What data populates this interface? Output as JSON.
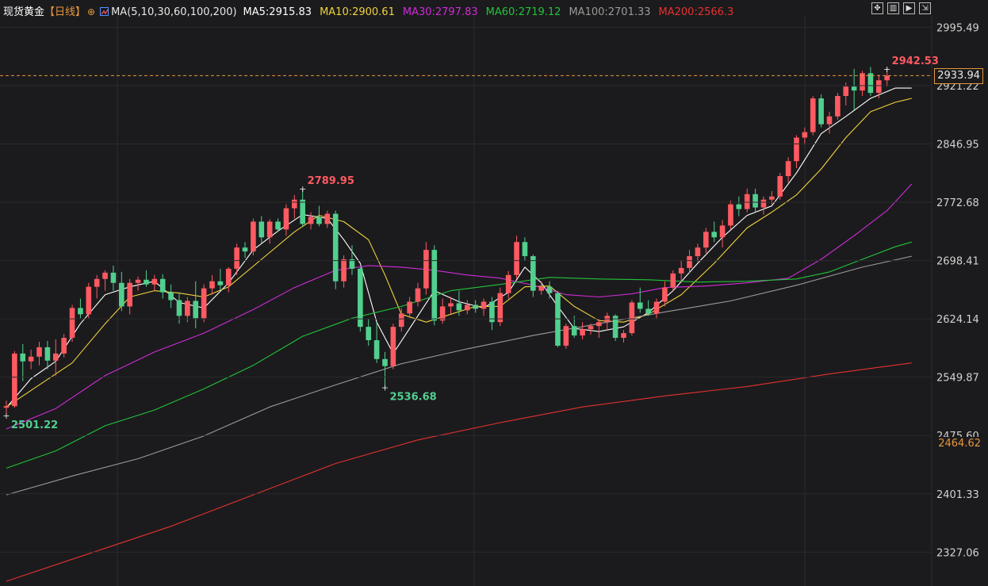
{
  "header": {
    "symbol": "现货黄金",
    "period": "【日线】",
    "period_icon": "circle-plus-icon",
    "ma_icon": "ma-indicator-icon",
    "ma_params": "MA(5,10,30,60,100,200)",
    "ma_values": [
      {
        "text": "MA5:2915.83",
        "color": "#ffffff"
      },
      {
        "text": "MA10:2900.61",
        "color": "#f0d23c"
      },
      {
        "text": "MA30:2797.83",
        "color": "#d02bd8"
      },
      {
        "text": "MA60:2719.12",
        "color": "#22c33a"
      },
      {
        "text": "MA100:2701.33",
        "color": "#9a9a9a"
      },
      {
        "text": "MA200:2566.3",
        "color": "#e5312e"
      }
    ]
  },
  "toolbar": {
    "buttons": [
      "move-icon",
      "chart-type-icon",
      "play-icon",
      "expand-icon"
    ]
  },
  "colors": {
    "background": "#1b1b1d",
    "up": "#ff5a62",
    "down": "#52cf8f",
    "last_price_line": "#e8963c",
    "grid": "#2b2b2e"
  },
  "chart_data": {
    "type": "candlestick",
    "ylim": [
      2290,
      3005
    ],
    "y_ticks": [
      "2995.49",
      "2921.22",
      "2846.95",
      "2772.68",
      "2698.41",
      "2624.14",
      "2549.87",
      "2475.60",
      "2401.33",
      "2327.06"
    ],
    "last_price": "2933.94",
    "period_low_label": "2464.62",
    "annotations": [
      {
        "text": "2942.53",
        "bar": 107,
        "value": 2942.53,
        "kind": "high"
      },
      {
        "text": "2789.95",
        "bar": 36,
        "value": 2789.95,
        "kind": "high"
      },
      {
        "text": "2536.68",
        "bar": 46,
        "value": 2536.68,
        "kind": "low"
      },
      {
        "text": "2501.22",
        "bar": 0,
        "value": 2501.22,
        "kind": "low"
      }
    ],
    "candles": [
      [
        2511,
        2520,
        2501.22,
        2513
      ],
      [
        2513,
        2583,
        2511,
        2580
      ],
      [
        2580,
        2592,
        2545,
        2570
      ],
      [
        2570,
        2585,
        2560,
        2576
      ],
      [
        2576,
        2595,
        2565,
        2588
      ],
      [
        2588,
        2596,
        2560,
        2571
      ],
      [
        2571,
        2598,
        2552,
        2580
      ],
      [
        2580,
        2605,
        2575,
        2600
      ],
      [
        2600,
        2642,
        2595,
        2638
      ],
      [
        2638,
        2650,
        2625,
        2630
      ],
      [
        2630,
        2670,
        2625,
        2665
      ],
      [
        2665,
        2680,
        2650,
        2675
      ],
      [
        2675,
        2686,
        2660,
        2683
      ],
      [
        2683,
        2692,
        2660,
        2670
      ],
      [
        2670,
        2684,
        2634,
        2640
      ],
      [
        2640,
        2675,
        2630,
        2670
      ],
      [
        2670,
        2678,
        2660,
        2674
      ],
      [
        2674,
        2686,
        2665,
        2668
      ],
      [
        2668,
        2680,
        2660,
        2675
      ],
      [
        2675,
        2681,
        2650,
        2658
      ],
      [
        2658,
        2668,
        2638,
        2648
      ],
      [
        2648,
        2658,
        2618,
        2628
      ],
      [
        2628,
        2652,
        2620,
        2647
      ],
      [
        2647,
        2672,
        2612,
        2625
      ],
      [
        2625,
        2668,
        2620,
        2663
      ],
      [
        2663,
        2680,
        2655,
        2672
      ],
      [
        2672,
        2688,
        2660,
        2667
      ],
      [
        2667,
        2690,
        2658,
        2688
      ],
      [
        2688,
        2720,
        2680,
        2715
      ],
      [
        2715,
        2722,
        2702,
        2710
      ],
      [
        2710,
        2752,
        2705,
        2748
      ],
      [
        2748,
        2755,
        2720,
        2728
      ],
      [
        2728,
        2751,
        2720,
        2748
      ],
      [
        2748,
        2752,
        2735,
        2738
      ],
      [
        2738,
        2770,
        2730,
        2765
      ],
      [
        2765,
        2782,
        2752,
        2776
      ],
      [
        2776,
        2789.95,
        2742,
        2745
      ],
      [
        2745,
        2760,
        2738,
        2754
      ],
      [
        2754,
        2768,
        2742,
        2745
      ],
      [
        2745,
        2762,
        2740,
        2758
      ],
      [
        2758,
        2762,
        2662,
        2672
      ],
      [
        2672,
        2705,
        2664,
        2700
      ],
      [
        2700,
        2718,
        2680,
        2688
      ],
      [
        2688,
        2690,
        2608,
        2614
      ],
      [
        2614,
        2624,
        2590,
        2597
      ],
      [
        2597,
        2620,
        2568,
        2573
      ],
      [
        2573,
        2582,
        2536.68,
        2564
      ],
      [
        2564,
        2618,
        2560,
        2614
      ],
      [
        2614,
        2638,
        2608,
        2631
      ],
      [
        2631,
        2652,
        2625,
        2646
      ],
      [
        2646,
        2670,
        2640,
        2663
      ],
      [
        2663,
        2722,
        2655,
        2712
      ],
      [
        2712,
        2718,
        2616,
        2622
      ],
      [
        2622,
        2650,
        2618,
        2640
      ],
      [
        2640,
        2652,
        2630,
        2644
      ],
      [
        2644,
        2660,
        2628,
        2635
      ],
      [
        2635,
        2648,
        2630,
        2642
      ],
      [
        2642,
        2648,
        2632,
        2637
      ],
      [
        2637,
        2650,
        2628,
        2646
      ],
      [
        2646,
        2652,
        2610,
        2620
      ],
      [
        2620,
        2664,
        2615,
        2657
      ],
      [
        2657,
        2685,
        2650,
        2680
      ],
      [
        2680,
        2730,
        2675,
        2722
      ],
      [
        2722,
        2728,
        2698,
        2704
      ],
      [
        2704,
        2706,
        2652,
        2660
      ],
      [
        2660,
        2672,
        2655,
        2665
      ],
      [
        2665,
        2672,
        2650,
        2657
      ],
      [
        2657,
        2660,
        2588,
        2590
      ],
      [
        2590,
        2618,
        2586,
        2615
      ],
      [
        2615,
        2628,
        2600,
        2603
      ],
      [
        2603,
        2620,
        2598,
        2611
      ],
      [
        2611,
        2618,
        2604,
        2615
      ],
      [
        2615,
        2624,
        2600,
        2620
      ],
      [
        2620,
        2632,
        2610,
        2628
      ],
      [
        2628,
        2630,
        2596,
        2600
      ],
      [
        2600,
        2610,
        2594,
        2606
      ],
      [
        2606,
        2648,
        2603,
        2645
      ],
      [
        2645,
        2664,
        2632,
        2637
      ],
      [
        2637,
        2648,
        2628,
        2631
      ],
      [
        2631,
        2650,
        2625,
        2646
      ],
      [
        2646,
        2672,
        2640,
        2664
      ],
      [
        2664,
        2686,
        2660,
        2682
      ],
      [
        2682,
        2698,
        2670,
        2689
      ],
      [
        2689,
        2712,
        2682,
        2704
      ],
      [
        2704,
        2720,
        2697,
        2715
      ],
      [
        2715,
        2740,
        2708,
        2735
      ],
      [
        2735,
        2748,
        2722,
        2728
      ],
      [
        2728,
        2750,
        2715,
        2743
      ],
      [
        2743,
        2775,
        2738,
        2770
      ],
      [
        2770,
        2780,
        2755,
        2764
      ],
      [
        2764,
        2790,
        2760,
        2783
      ],
      [
        2783,
        2790,
        2760,
        2766
      ],
      [
        2766,
        2780,
        2757,
        2776
      ],
      [
        2776,
        2787,
        2770,
        2780
      ],
      [
        2780,
        2810,
        2776,
        2806
      ],
      [
        2806,
        2830,
        2798,
        2825
      ],
      [
        2825,
        2858,
        2816,
        2855
      ],
      [
        2855,
        2868,
        2846,
        2862
      ],
      [
        2862,
        2908,
        2858,
        2905
      ],
      [
        2905,
        2910,
        2868,
        2872
      ],
      [
        2872,
        2888,
        2860,
        2882
      ],
      [
        2882,
        2912,
        2878,
        2908
      ],
      [
        2908,
        2925,
        2896,
        2920
      ],
      [
        2920,
        2942.53,
        2890,
        2915
      ],
      [
        2915,
        2940,
        2908,
        2937
      ],
      [
        2937,
        2945,
        2908,
        2912
      ],
      [
        2912,
        2935,
        2905,
        2928
      ],
      [
        2928,
        2945,
        2920,
        2934
      ]
    ],
    "series": [
      {
        "name": "MA5",
        "color": "#ffffff",
        "points": [
          [
            0,
            2511
          ],
          [
            3,
            2548
          ],
          [
            6,
            2570
          ],
          [
            9,
            2618
          ],
          [
            12,
            2655
          ],
          [
            15,
            2665
          ],
          [
            18,
            2672
          ],
          [
            21,
            2645
          ],
          [
            24,
            2638
          ],
          [
            27,
            2670
          ],
          [
            30,
            2712
          ],
          [
            33,
            2736
          ],
          [
            36,
            2757
          ],
          [
            39,
            2752
          ],
          [
            41,
            2725
          ],
          [
            43,
            2695
          ],
          [
            45,
            2620
          ],
          [
            47,
            2580
          ],
          [
            49,
            2612
          ],
          [
            52,
            2660
          ],
          [
            55,
            2646
          ],
          [
            58,
            2638
          ],
          [
            61,
            2658
          ],
          [
            63,
            2690
          ],
          [
            65,
            2670
          ],
          [
            67,
            2640
          ],
          [
            69,
            2612
          ],
          [
            72,
            2608
          ],
          [
            75,
            2614
          ],
          [
            78,
            2632
          ],
          [
            81,
            2660
          ],
          [
            84,
            2695
          ],
          [
            87,
            2728
          ],
          [
            90,
            2756
          ],
          [
            93,
            2768
          ],
          [
            96,
            2810
          ],
          [
            99,
            2860
          ],
          [
            102,
            2882
          ],
          [
            105,
            2905
          ],
          [
            108,
            2918
          ],
          [
            110,
            2918
          ]
        ]
      },
      {
        "name": "MA10",
        "color": "#f0d23c",
        "points": [
          [
            0,
            2512
          ],
          [
            4,
            2540
          ],
          [
            8,
            2568
          ],
          [
            12,
            2618
          ],
          [
            15,
            2652
          ],
          [
            18,
            2660
          ],
          [
            21,
            2657
          ],
          [
            24,
            2652
          ],
          [
            27,
            2665
          ],
          [
            31,
            2700
          ],
          [
            35,
            2735
          ],
          [
            38,
            2756
          ],
          [
            41,
            2748
          ],
          [
            44,
            2725
          ],
          [
            46,
            2680
          ],
          [
            48,
            2630
          ],
          [
            51,
            2620
          ],
          [
            54,
            2630
          ],
          [
            57,
            2640
          ],
          [
            60,
            2640
          ],
          [
            63,
            2665
          ],
          [
            66,
            2666
          ],
          [
            69,
            2640
          ],
          [
            72,
            2622
          ],
          [
            75,
            2620
          ],
          [
            78,
            2630
          ],
          [
            82,
            2655
          ],
          [
            86,
            2695
          ],
          [
            90,
            2740
          ],
          [
            93,
            2760
          ],
          [
            96,
            2782
          ],
          [
            99,
            2815
          ],
          [
            102,
            2855
          ],
          [
            105,
            2888
          ],
          [
            108,
            2900
          ],
          [
            110,
            2905
          ]
        ]
      },
      {
        "name": "MA30",
        "color": "#d02bd8",
        "points": [
          [
            0,
            2484
          ],
          [
            6,
            2510
          ],
          [
            12,
            2552
          ],
          [
            18,
            2582
          ],
          [
            24,
            2606
          ],
          [
            30,
            2636
          ],
          [
            35,
            2664
          ],
          [
            40,
            2686
          ],
          [
            44,
            2692
          ],
          [
            48,
            2690
          ],
          [
            52,
            2686
          ],
          [
            56,
            2680
          ],
          [
            60,
            2676
          ],
          [
            64,
            2667
          ],
          [
            68,
            2655
          ],
          [
            72,
            2652
          ],
          [
            76,
            2656
          ],
          [
            80,
            2664
          ],
          [
            85,
            2666
          ],
          [
            90,
            2670
          ],
          [
            95,
            2676
          ],
          [
            99,
            2700
          ],
          [
            103,
            2730
          ],
          [
            107,
            2762
          ],
          [
            110,
            2796
          ]
        ]
      },
      {
        "name": "MA60",
        "color": "#22c33a",
        "points": [
          [
            0,
            2434
          ],
          [
            6,
            2456
          ],
          [
            12,
            2488
          ],
          [
            18,
            2508
          ],
          [
            24,
            2535
          ],
          [
            30,
            2565
          ],
          [
            36,
            2602
          ],
          [
            42,
            2625
          ],
          [
            48,
            2640
          ],
          [
            54,
            2660
          ],
          [
            60,
            2668
          ],
          [
            66,
            2677
          ],
          [
            72,
            2675
          ],
          [
            78,
            2674
          ],
          [
            84,
            2671
          ],
          [
            90,
            2672
          ],
          [
            96,
            2675
          ],
          [
            100,
            2684
          ],
          [
            104,
            2700
          ],
          [
            108,
            2716
          ],
          [
            110,
            2722
          ]
        ]
      },
      {
        "name": "MA100",
        "color": "#9a9a9a",
        "points": [
          [
            0,
            2400
          ],
          [
            8,
            2424
          ],
          [
            16,
            2446
          ],
          [
            24,
            2475
          ],
          [
            32,
            2512
          ],
          [
            40,
            2540
          ],
          [
            48,
            2567
          ],
          [
            56,
            2586
          ],
          [
            64,
            2603
          ],
          [
            72,
            2618
          ],
          [
            80,
            2633
          ],
          [
            88,
            2647
          ],
          [
            96,
            2667
          ],
          [
            104,
            2690
          ],
          [
            110,
            2704
          ]
        ]
      },
      {
        "name": "MA200",
        "color": "#e5312e",
        "points": [
          [
            0,
            2290
          ],
          [
            10,
            2325
          ],
          [
            20,
            2360
          ],
          [
            30,
            2400
          ],
          [
            40,
            2440
          ],
          [
            50,
            2470
          ],
          [
            60,
            2492
          ],
          [
            70,
            2512
          ],
          [
            80,
            2526
          ],
          [
            90,
            2538
          ],
          [
            100,
            2554
          ],
          [
            110,
            2568
          ]
        ]
      }
    ]
  }
}
